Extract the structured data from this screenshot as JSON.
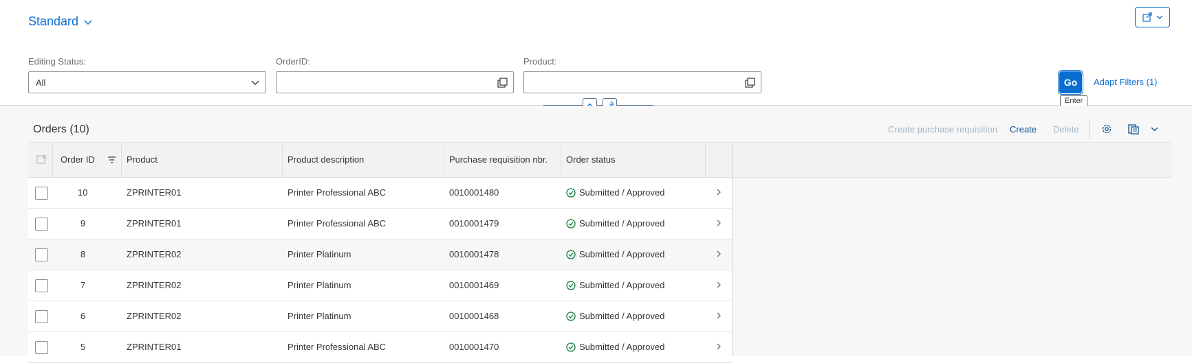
{
  "variant": {
    "label": "Standard"
  },
  "filters": [
    {
      "label": "Editing Status:",
      "value": "All",
      "placeholder": ""
    },
    {
      "label": "OrderID:",
      "value": "",
      "placeholder": ""
    },
    {
      "label": "Product:",
      "value": "",
      "placeholder": ""
    }
  ],
  "go_button": {
    "label": "Go",
    "tooltip": "Enter"
  },
  "adapt_filters": {
    "label": "Adapt Filters (1)"
  },
  "table": {
    "title": "Orders (10)",
    "toolbar": {
      "create_pr_label": "Create purchase requisition",
      "create_label": "Create",
      "delete_label": "Delete"
    },
    "columns": [
      "Order ID",
      "Product",
      "Product description",
      "Purchase requisition nbr.",
      "Order status"
    ],
    "rows": [
      {
        "order_id": "10",
        "product": "ZPRINTER01",
        "description": "Printer Professional ABC",
        "pr_nbr": "0010001480",
        "status": "Submitted / Approved"
      },
      {
        "order_id": "9",
        "product": "ZPRINTER01",
        "description": "Printer Professional ABC",
        "pr_nbr": "0010001479",
        "status": "Submitted / Approved"
      },
      {
        "order_id": "8",
        "product": "ZPRINTER02",
        "description": "Printer Platinum",
        "pr_nbr": "0010001478",
        "status": "Submitted / Approved"
      },
      {
        "order_id": "7",
        "product": "ZPRINTER02",
        "description": "Printer Platinum",
        "pr_nbr": "0010001469",
        "status": "Submitted / Approved"
      },
      {
        "order_id": "6",
        "product": "ZPRINTER02",
        "description": "Printer Platinum",
        "pr_nbr": "0010001468",
        "status": "Submitted / Approved"
      },
      {
        "order_id": "5",
        "product": "ZPRINTER01",
        "description": "Printer Professional ABC",
        "pr_nbr": "0010001470",
        "status": "Submitted / Approved"
      }
    ]
  },
  "colors": {
    "accent": "#0a6ed1",
    "success": "#107e3e",
    "disabled": "#a3b4c6"
  },
  "icons": [
    "chevron-down-icon",
    "share-icon",
    "value-help-icon",
    "collapse-icon",
    "pin-icon",
    "settings-icon",
    "export-icon",
    "sort-icon",
    "select-all-icon",
    "status-check-icon",
    "row-navigation-icon"
  ]
}
